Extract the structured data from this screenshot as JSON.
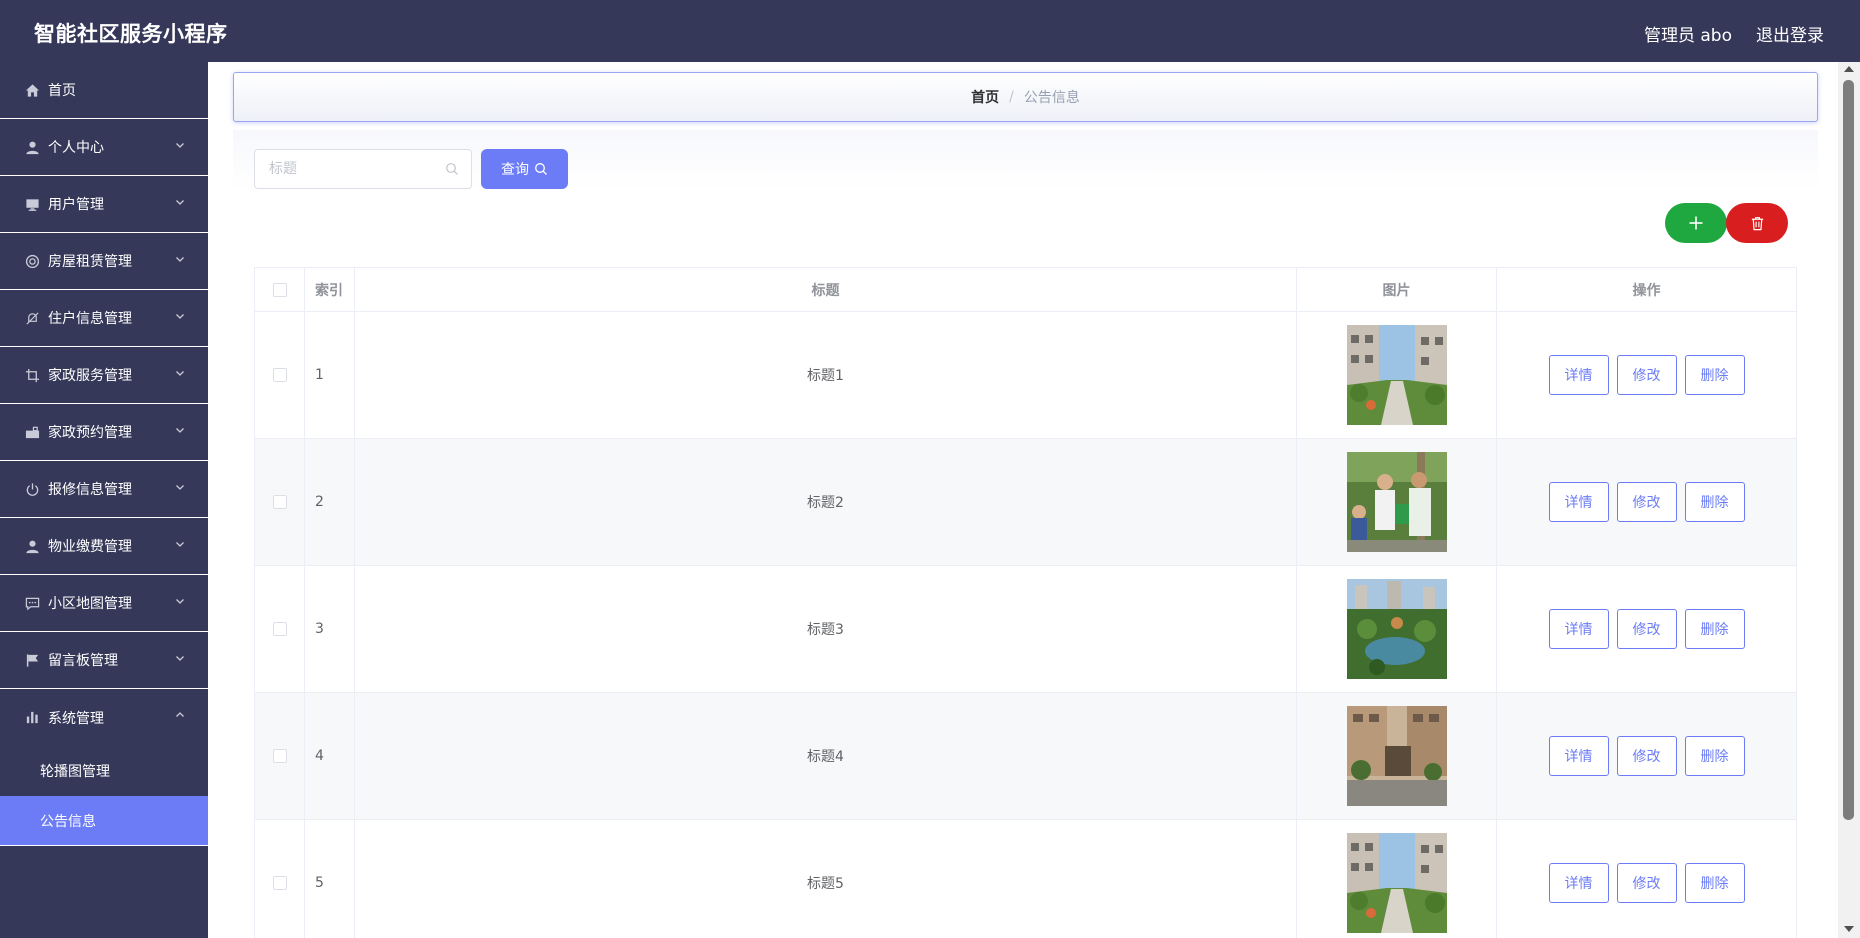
{
  "app": {
    "title": "智能社区服务小程序"
  },
  "header": {
    "user_label": "管理员 abo",
    "logout_label": "退出登录"
  },
  "sidebar": {
    "items": [
      {
        "label": "首页",
        "icon": "home-icon"
      },
      {
        "label": "个人中心",
        "icon": "user-icon"
      },
      {
        "label": "用户管理",
        "icon": "monitor-icon"
      },
      {
        "label": "房屋租赁管理",
        "icon": "lifebuoy-icon"
      },
      {
        "label": "住户信息管理",
        "icon": "bell-off-icon"
      },
      {
        "label": "家政服务管理",
        "icon": "crop-icon"
      },
      {
        "label": "家政预约管理",
        "icon": "suitcase-icon"
      },
      {
        "label": "报修信息管理",
        "icon": "power-icon"
      },
      {
        "label": "物业缴费管理",
        "icon": "user-icon"
      },
      {
        "label": "小区地图管理",
        "icon": "chat-icon"
      },
      {
        "label": "留言板管理",
        "icon": "flag-icon"
      },
      {
        "label": "系统管理",
        "icon": "bar-chart-icon"
      }
    ],
    "sub_items": [
      {
        "label": "轮播图管理"
      },
      {
        "label": "公告信息"
      }
    ]
  },
  "breadcrumb": {
    "home": "首页",
    "separator": "/",
    "current": "公告信息"
  },
  "search": {
    "placeholder": "标题",
    "value": "",
    "button_label": "查询"
  },
  "table": {
    "headers": {
      "index": "索引",
      "title": "标题",
      "image": "图片",
      "actions": "操作"
    },
    "rows": [
      {
        "index": "1",
        "title": "标题1",
        "image": "community-street-photo"
      },
      {
        "index": "2",
        "title": "标题2",
        "image": "volunteers-photo"
      },
      {
        "index": "3",
        "title": "标题3",
        "image": "garden-pond-photo"
      },
      {
        "index": "4",
        "title": "标题4",
        "image": "apartment-entrance-photo"
      },
      {
        "index": "5",
        "title": "标题5",
        "image": "community-street-photo"
      }
    ],
    "actions": {
      "detail": "详情",
      "edit": "修改",
      "delete": "删除"
    }
  },
  "colors": {
    "sidebar_bg": "#36385a",
    "accent": "#6b7cf6",
    "add_button": "#1ea83f",
    "delete_button": "#d81e1e"
  }
}
